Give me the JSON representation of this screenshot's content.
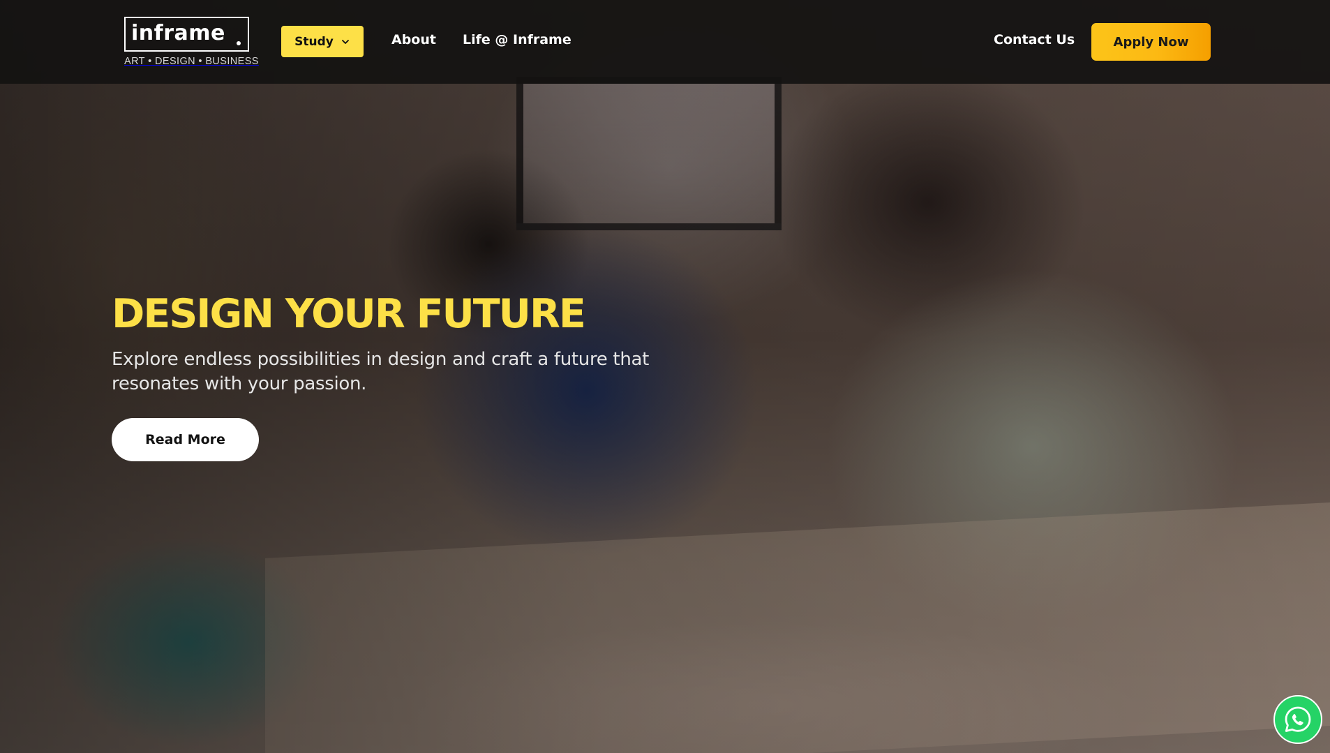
{
  "brand": {
    "name": "inframe",
    "tagline": "ART • DESIGN • BUSINESS"
  },
  "nav": {
    "study_label": "Study",
    "about_label": "About",
    "life_label": "Life @ Inframe",
    "contact_label": "Contact Us",
    "apply_label": "Apply Now"
  },
  "hero": {
    "title": "DESIGN YOUR FUTURE",
    "subtitle": "Explore endless possibilities in design and craft a future that resonates with your passion.",
    "cta_label": "Read More",
    "image_alt": "students-sketching-photo"
  },
  "floating": {
    "whatsapp_icon": "whatsapp-icon"
  },
  "colors": {
    "accent_yellow": "#fde047",
    "apply_gradient_start": "#fcc419",
    "apply_gradient_end": "#f59f00",
    "header_bg": "#141211",
    "whatsapp_green": "#25d366"
  }
}
